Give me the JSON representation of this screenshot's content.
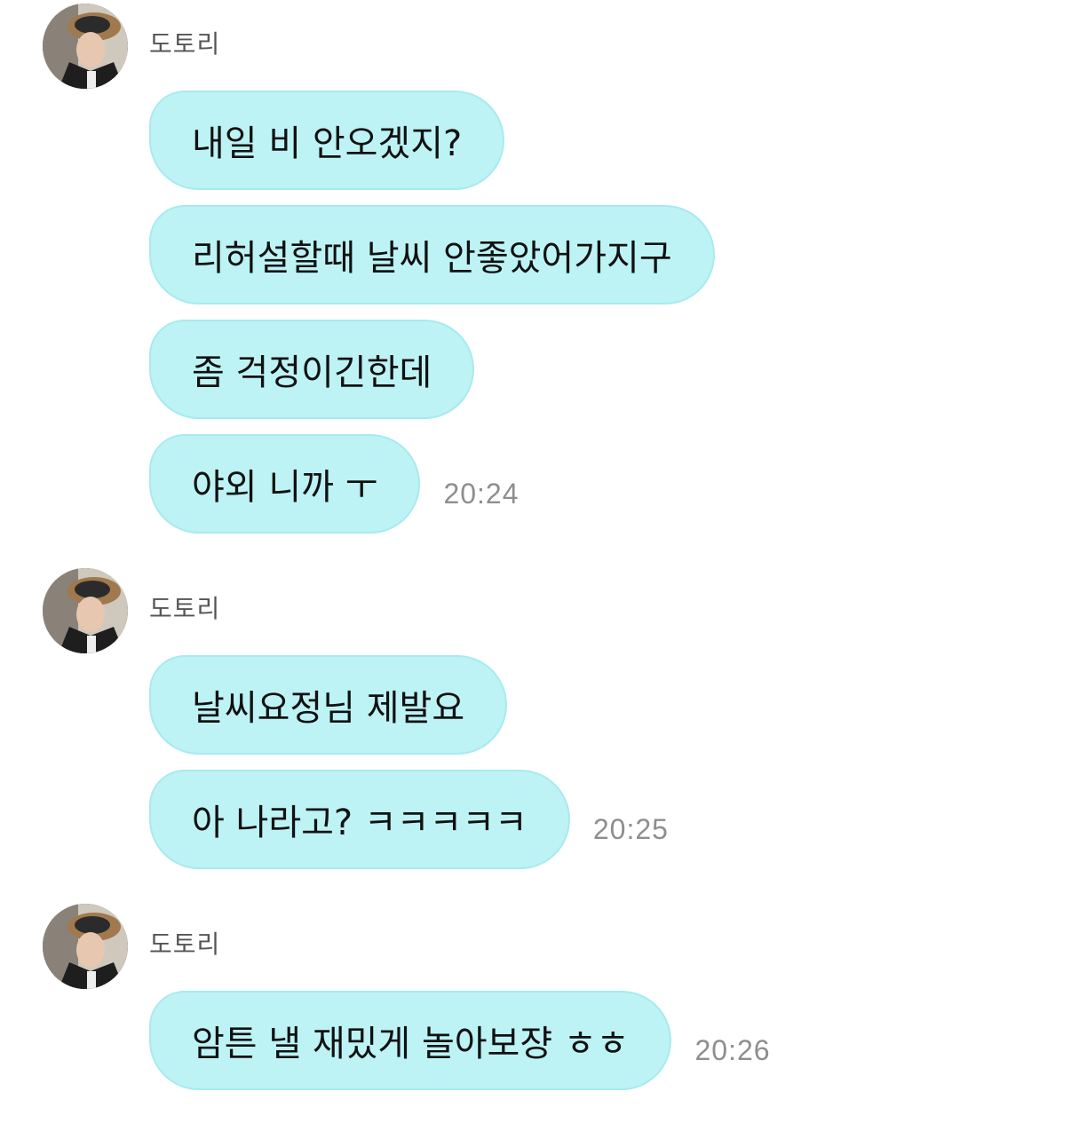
{
  "groups": [
    {
      "sender": "도토리",
      "messages": [
        {
          "text": "내일 비 안오겠지?",
          "time": ""
        },
        {
          "text": "리허설할때 날씨 안좋았어가지구",
          "time": ""
        },
        {
          "text": "좀 걱정이긴한데",
          "time": ""
        },
        {
          "text": "야외 니까 ㅜ",
          "time": "20:24"
        }
      ]
    },
    {
      "sender": "도토리",
      "messages": [
        {
          "text": "날씨요정님 제발요",
          "time": ""
        },
        {
          "text": "아 나라고? ㅋㅋㅋㅋㅋ",
          "time": "20:25"
        }
      ]
    },
    {
      "sender": "도토리",
      "messages": [
        {
          "text": "암튼 낼 재밌게 놀아보쟝 ㅎㅎ",
          "time": "20:26"
        }
      ]
    }
  ],
  "colors": {
    "bubble": "#bdf3f5",
    "bubble_border": "#a8eaee",
    "time": "#8e8e8e",
    "sender": "#555555"
  }
}
